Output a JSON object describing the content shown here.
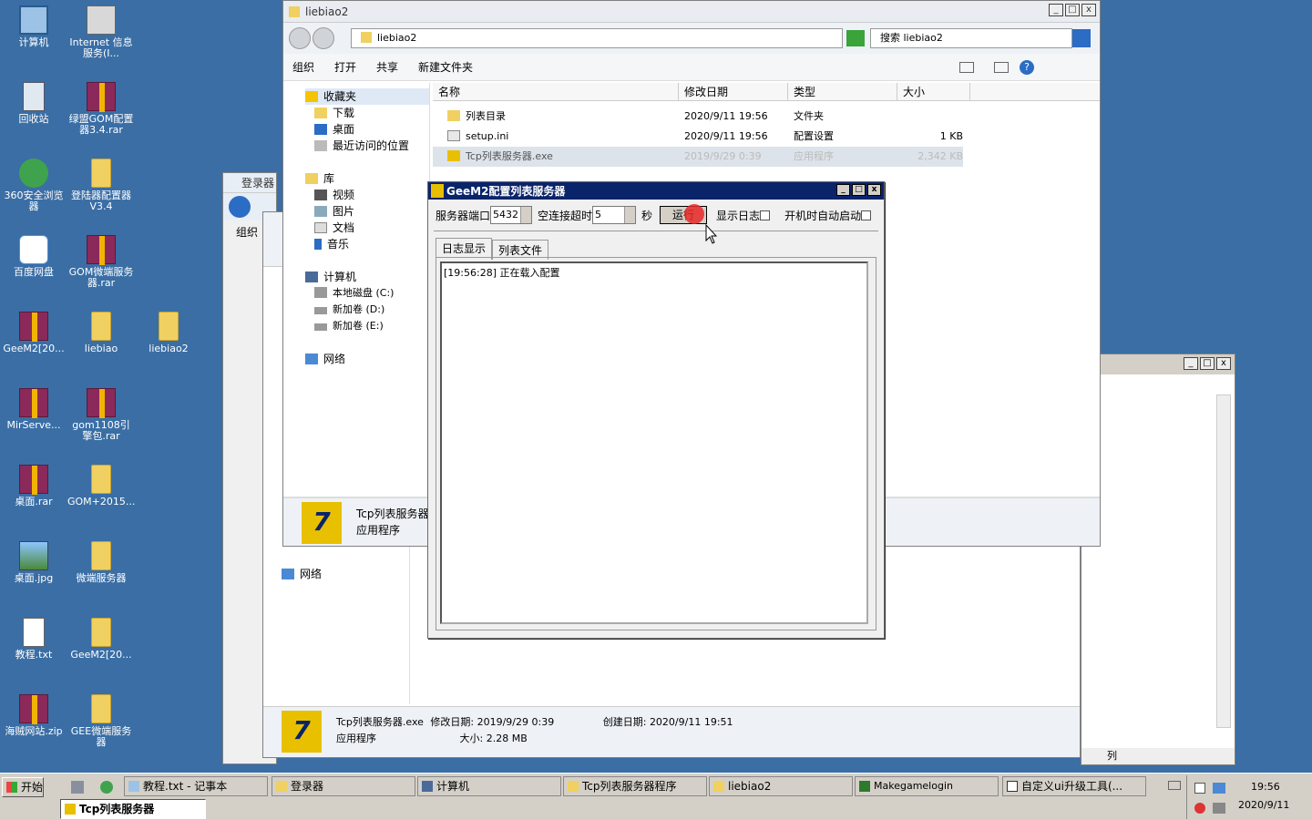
{
  "desktop": {
    "icons": [
      {
        "label": "计算机",
        "x": 0,
        "y": 0
      },
      {
        "label": "Internet 信息服务(I...",
        "x": 0,
        "y": 0
      },
      {
        "label": "回收站",
        "x": 0,
        "y": 0
      },
      {
        "label": "绿盟GOM配置器3.4.rar",
        "x": 0,
        "y": 0
      },
      {
        "label": "360安全浏览器",
        "x": 0,
        "y": 0
      },
      {
        "label": "登陆器配置器V3.4",
        "x": 0,
        "y": 0
      },
      {
        "label": "百度网盘",
        "x": 0,
        "y": 0
      },
      {
        "label": "GOM微端服务器.rar",
        "x": 0,
        "y": 0
      },
      {
        "label": "GeeM2[20...",
        "x": 0,
        "y": 0
      },
      {
        "label": "liebiao",
        "x": 0,
        "y": 0
      },
      {
        "label": "liebiao2",
        "x": 0,
        "y": 0
      },
      {
        "label": "MirServe...",
        "x": 0,
        "y": 0
      },
      {
        "label": "gom1108引擎包.rar",
        "x": 0,
        "y": 0
      },
      {
        "label": "桌面.rar",
        "x": 0,
        "y": 0
      },
      {
        "label": "GOM+2015...",
        "x": 0,
        "y": 0
      },
      {
        "label": "桌面.jpg",
        "x": 0,
        "y": 0
      },
      {
        "label": "微端服务器",
        "x": 0,
        "y": 0
      },
      {
        "label": "教程.txt",
        "x": 0,
        "y": 0
      },
      {
        "label": "GeeM2[20...",
        "x": 0,
        "y": 0
      },
      {
        "label": "海贼网站.zip",
        "x": 0,
        "y": 0
      },
      {
        "label": "GEE微端服务器",
        "x": 0,
        "y": 0
      }
    ]
  },
  "explorer": {
    "title": "liebiao2",
    "address": "liebiao2",
    "search_placeholder": "搜索 liebiao2",
    "toolbar": {
      "organize": "组织",
      "open": "打开",
      "share": "共享",
      "new_folder": "新建文件夹"
    },
    "nav": {
      "favorites": "收藏夹",
      "downloads": "下载",
      "desktop": "桌面",
      "recent": "最近访问的位置",
      "library": "库",
      "video": "视频",
      "pictures": "图片",
      "documents": "文档",
      "music": "音乐",
      "computer": "计算机",
      "disk_c": "本地磁盘 (C:)",
      "disk_d": "新加卷 (D:)",
      "disk_e": "新加卷 (E:)",
      "network": "网络"
    },
    "columns": {
      "name": "名称",
      "modified": "修改日期",
      "type": "类型",
      "size": "大小"
    },
    "files": [
      {
        "name": "列表目录",
        "modified": "2020/9/11 19:56",
        "type": "文件夹",
        "size": ""
      },
      {
        "name": "setup.ini",
        "modified": "2020/9/11 19:56",
        "type": "配置设置",
        "size": "1 KB"
      },
      {
        "name": "Tcp列表服务器.exe",
        "modified": "2019/9/29 0:39",
        "type": "应用程序",
        "size": "2,342 KB"
      }
    ],
    "details": {
      "name": "Tcp列表服务器",
      "type": "应用程序"
    }
  },
  "back_explorer": {
    "title": "登录器",
    "organize": "组织",
    "network": "网络",
    "details": {
      "name": "Tcp列表服务器.exe",
      "modified_label": "修改日期:",
      "modified": "2019/9/29 0:39",
      "created_label": "创建日期:",
      "created": "2020/9/11 19:51",
      "type": "应用程序",
      "size_label": "大小:",
      "size": "2.28 MB"
    }
  },
  "right_window": {
    "status": "列"
  },
  "dialog": {
    "title": "GeeM2配置列表服务器",
    "port_label": "服务器端口",
    "port": "5432",
    "timeout_label": "空连接超时",
    "timeout": "5",
    "seconds": "秒",
    "run_button": "运行",
    "show_log": "显示日志",
    "autostart": "开机时自动启动",
    "tabs": [
      "日志显示",
      "列表文件"
    ],
    "log": "[19:56:28] 正在载入配置"
  },
  "taskbar": {
    "start": "开始",
    "items": [
      "教程.txt - 记事本",
      "登录器",
      "计算机",
      "Tcp列表服务器程序",
      "liebiao2",
      "Makegamelogin",
      "自定义ui升级工具(..."
    ],
    "active_item": "Tcp列表服务器",
    "time": "19:56",
    "date": "2020/9/11"
  }
}
